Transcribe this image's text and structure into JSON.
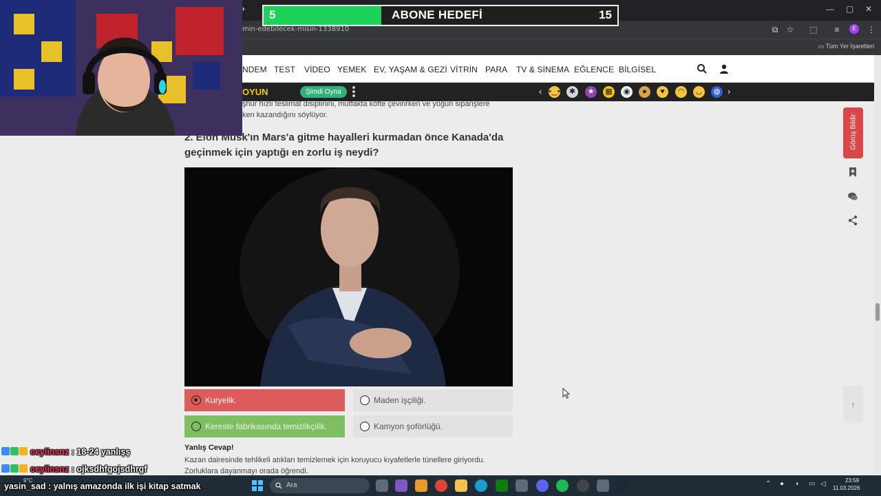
{
  "browser": {
    "url": "min-edebilecek-misin-1338910",
    "bookmarks_label": "Tüm Yer İşaretleri",
    "profile_initial": "E",
    "new_tab": "+"
  },
  "nav": {
    "items": [
      "NDEM",
      "TEST",
      "VİDEO",
      "YEMEK",
      "EV, YAŞAM & GEZİ",
      "VİTRİN",
      "PARA",
      "TV & SİNEMA",
      "EĞLENCE",
      "BİLGİSEL"
    ]
  },
  "gamebar": {
    "title": "OYUN",
    "play_label": "Şimdi Oyna",
    "prev": "‹",
    "next": "›",
    "icons": [
      "emoji-1",
      "basketball",
      "emoji-3",
      "emoji-4",
      "gamepad",
      "emoji-6",
      "heart-eyes",
      "sad",
      "smile",
      "globe"
    ]
  },
  "article": {
    "prev_text_line1": "şhur hızlı teslimat disiplinini, mutfakta köfte çevirirken ve yoğun siparişlere",
    "prev_text_line2": "ken kazandığını söylüyor.",
    "question": "2. Elon Musk'ın Mars'a gitme hayalleri kurmadan önce Kanada'da geçinmek için yaptığı en zorlu iş neydi?",
    "options": [
      {
        "label": "Kuryelik.",
        "state": "selected-wrong"
      },
      {
        "label": "Maden işçiliği.",
        "state": "neutral"
      },
      {
        "label": "Kereste fabrikasında temizlikçilik.",
        "state": "correct"
      },
      {
        "label": "Kamyon şoförlüğü.",
        "state": "neutral"
      }
    ],
    "result_title": "Yanlış Cevap!",
    "result_line1": "Kazan dairesinde tehlikeli atıkları temizlemek için koruyucu kıyafetlerle tünellere giriyordu.",
    "result_line2": "Zorluklara dayanmayı orada öğrendi."
  },
  "sidebar": {
    "feedback_label": "Görüş Bildir",
    "to_top": "↑"
  },
  "stream": {
    "sub_goal_current": "5",
    "sub_goal_title": "ABONE HEDEFİ",
    "sub_goal_target": "15",
    "sub_goal_progress": 0.333,
    "chat": [
      {
        "user": "ceylinsnz",
        "message": ": 18-24 yanlışş"
      },
      {
        "user": "ceylinsnz",
        "message": ": ojksdhfgojsdhrgf"
      },
      {
        "user": "yasin_sad",
        "message": ": yalnış amazonda ilk işi kitap satmak"
      }
    ]
  },
  "taskbar": {
    "weather": "9°C",
    "search_label": "Ara",
    "time": "23:59",
    "date": "11.03.2026"
  },
  "colors": {
    "wrong": "#de5b5b",
    "correct": "#7fbf62",
    "feedback": "#d9474b",
    "sub_fill": "#1dd15b"
  }
}
